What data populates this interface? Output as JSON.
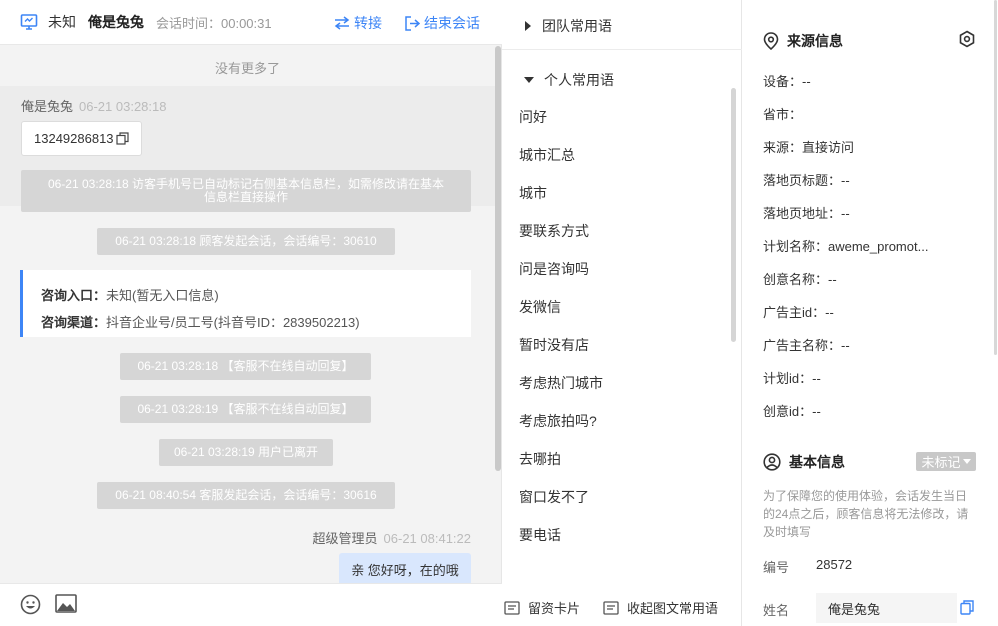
{
  "header": {
    "status": "未知",
    "visitor_name": "俺是兔兔",
    "session_time": "会话时间：00:00:31",
    "transfer": "转接",
    "end_session": "结束会话"
  },
  "chat": {
    "no_more": "没有更多了",
    "visitor_name": "俺是兔兔",
    "visitor_time": "06-21 03:28:18",
    "phone": "13249286813",
    "sys_phone_line1": "06-21 03:28:18 访客手机号已自动标记右侧基本信息栏，如需修改请在基本",
    "sys_phone_line2": "信息栏直接操作",
    "sys_start": "06-21 03:28:18 顾客发起会话，会话编号：30610",
    "card_entry_label": "咨询入口：",
    "card_entry_value": "未知(暂无入口信息)",
    "card_channel_label": "咨询渠道：",
    "card_channel_value": "抖音企业号/员工号(抖音号ID：2839502213)",
    "sys_auto1": "06-21 03:28:18 【客服不在线自动回复】",
    "sys_auto2": "06-21 03:28:19 【客服不在线自动回复】",
    "sys_left": "06-21 03:28:19 用户已离开",
    "sys_agent_start": "06-21 08:40:54 客服发起会话，会话编号：30616",
    "agent_name": "超级管理员",
    "agent_time": "06-21 08:41:22",
    "agent_msg": "亲 您好呀，在的哦"
  },
  "phrases": {
    "team_group": "团队常用语",
    "personal_group": "个人常用语",
    "items": [
      "问好",
      "城市汇总",
      "城市",
      "要联系方式",
      "问是咨询吗",
      "发微信",
      "暂时没有店",
      "考虑热门城市",
      "考虑旅拍吗?",
      "去哪拍",
      "窗口发不了",
      "要电话"
    ],
    "card_btn": "留资卡片",
    "collect_btn": "收起图文常用语"
  },
  "source": {
    "title": "来源信息",
    "device": "设备：--",
    "province": "省市：",
    "origin": "来源：直接访问",
    "landing_title": "落地页标题：--",
    "landing_url": "落地页地址：--",
    "plan_name": "计划名称：aweme_promot...",
    "creative_name": "创意名称：--",
    "advertiser_id": "广告主id：--",
    "advertiser_name": "广告主名称：--",
    "plan_id": "计划id：--",
    "creative_id": "创意id：--"
  },
  "basic": {
    "title": "基本信息",
    "tag": "未标记",
    "notice": "为了保障您的使用体验，会话发生当日的24点之后，顾客信息将无法修改，请及时填写",
    "number_label": "编号",
    "number_value": "28572",
    "name_label": "姓名",
    "name_value": "俺是兔兔"
  },
  "colors": {
    "accent": "#3d85f6",
    "sys_bg": "#d6d6d6",
    "agent_bubble": "#d9e7fd"
  }
}
